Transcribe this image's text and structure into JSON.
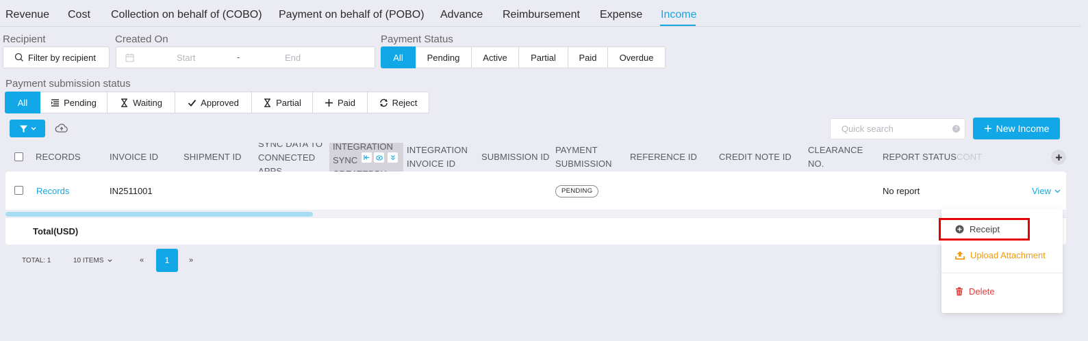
{
  "tabs": [
    {
      "label": "Revenue"
    },
    {
      "label": "Cost"
    },
    {
      "label": "Collection on behalf of (COBO)"
    },
    {
      "label": "Payment on behalf of (POBO)"
    },
    {
      "label": "Advance"
    },
    {
      "label": "Reimbursement"
    },
    {
      "label": "Expense"
    },
    {
      "label": "Income"
    }
  ],
  "active_tab": "Income",
  "filters": {
    "recipient": {
      "label": "Recipient",
      "button": "Filter by recipient"
    },
    "created_on": {
      "label": "Created On",
      "start_placeholder": "Start",
      "separator": "-",
      "end_placeholder": "End"
    },
    "payment_status": {
      "label": "Payment Status",
      "options": [
        "All",
        "Pending",
        "Active",
        "Partial",
        "Paid",
        "Overdue"
      ],
      "selected": "All"
    },
    "submission_status": {
      "label": "Payment submission status",
      "options": [
        "All",
        "Pending",
        "Waiting",
        "Approved",
        "Partial",
        "Paid",
        "Reject"
      ],
      "selected": "All"
    }
  },
  "toolbar": {
    "search_placeholder": "Quick search",
    "help_glyph": "?",
    "new_button": "New Income"
  },
  "table": {
    "columns": [
      "RECORDS",
      "INVOICE ID",
      "SHIPMENT ID",
      "SYNC DATA TO CONNECTED APPS",
      "INTEGRATION SYNC CREATEDBY",
      "INTEGRATION INVOICE ID",
      "SUBMISSION ID",
      "PAYMENT SUBMISSION",
      "REFERENCE ID",
      "CREDIT NOTE ID",
      "CLEARANCE NO.",
      "REPORT STATUS",
      "CONT"
    ],
    "rows": [
      {
        "records": "Records",
        "invoice_id": "IN2511001",
        "payment_submission": "PENDING",
        "report_status": "No report",
        "action": "View"
      }
    ],
    "total_label": "Total(USD)"
  },
  "pagination": {
    "total": "TOTAL: 1",
    "page_size": "10 ITEMS",
    "prev": "«",
    "current": "1",
    "next": "»"
  },
  "action_menu": {
    "items": [
      {
        "label": "Receipt",
        "color": "#444444",
        "icon": "plus-circle-icon"
      },
      {
        "label": "Upload Attachment",
        "color": "#f29a0c",
        "icon": "upload-icon"
      },
      {
        "label": "Delete",
        "color": "#e53935",
        "icon": "trash-icon"
      }
    ]
  },
  "colors": {
    "accent": "#12a8e8",
    "highlight": "#e60000"
  }
}
